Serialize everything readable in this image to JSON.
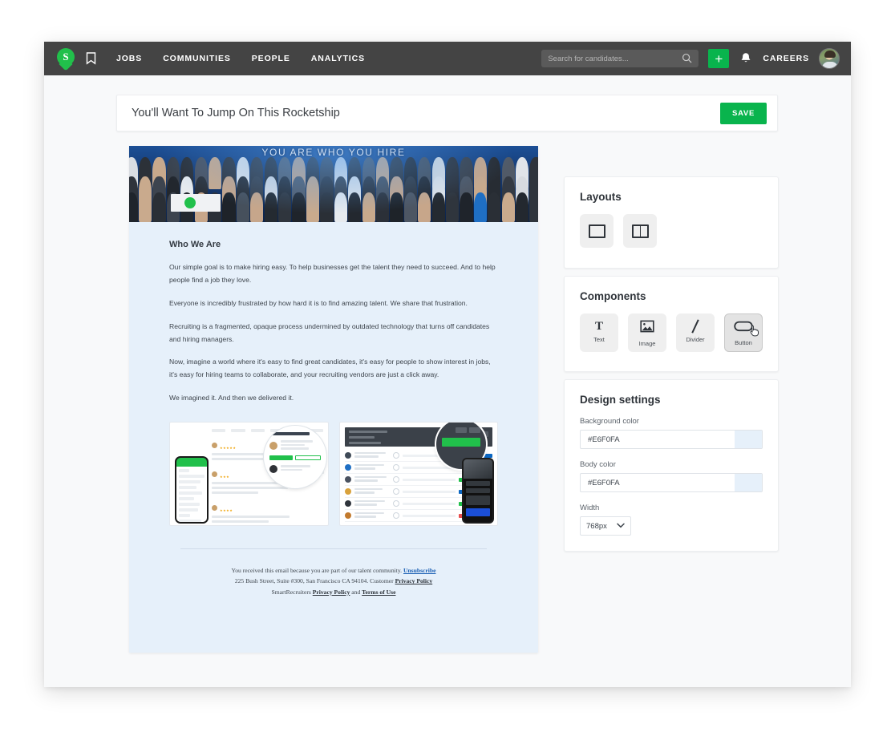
{
  "topnav": {
    "logo_letter": "S",
    "logo_name": "smartrecruiters-logo",
    "bookmark_icon": "bookmark-icon",
    "links": [
      {
        "label": "JOBS"
      },
      {
        "label": "COMMUNITIES"
      },
      {
        "label": "PEOPLE"
      },
      {
        "label": "ANALYTICS"
      }
    ],
    "search": {
      "placeholder": "Search for candidates...",
      "value": ""
    },
    "plus_label": "+",
    "bell_icon": "bell-icon",
    "careers_label": "CAREERS",
    "avatar": "user-avatar"
  },
  "titlebar": {
    "title": "You'll Want To Jump On This Rocketship",
    "save_label": "SAVE"
  },
  "email": {
    "hero_headline": "YOU ARE WHO YOU HIRE",
    "heading": "Who We Are",
    "paragraphs": [
      "Our simple goal is to make hiring easy. To help businesses get the talent they need to succeed. And to help people find a job they love.",
      "Everyone is incredibly frustrated by how hard it is to find amazing talent. We share that frustration.",
      "Recruiting is a fragmented, opaque process undermined by outdated technology that turns off candidates and hiring managers.",
      "Now, imagine a world where it's easy to find great candidates, it's easy for people to show interest in jobs, it's easy for hiring teams to collaborate, and your recruiting vendors are just a click away.",
      "We imagined it. And then we delivered it."
    ],
    "footer": {
      "line1_text": "You received this email because you are part of our talent community. ",
      "line1_link": "Unsubscribe",
      "line2_text": "225 Bush Street, Suite #300, San Francisco CA 94104. Customer ",
      "line2_link": "Privacy Policy",
      "line3_prefix": "SmartRecruiters ",
      "line3_link1": "Privacy Policy",
      "line3_mid": " and ",
      "line3_link2": "Terms of Use"
    }
  },
  "layouts_panel": {
    "title": "Layouts",
    "tiles": [
      {
        "name": "layout-single-column",
        "icon": "single-column-icon"
      },
      {
        "name": "layout-two-column",
        "icon": "two-column-icon"
      }
    ]
  },
  "components_panel": {
    "title": "Components",
    "items": [
      {
        "label": "Text",
        "icon": "text-icon",
        "selected": false
      },
      {
        "label": "Image",
        "icon": "image-icon",
        "selected": false
      },
      {
        "label": "Divider",
        "icon": "divider-icon",
        "selected": false
      },
      {
        "label": "Button",
        "icon": "button-icon",
        "selected": true
      }
    ]
  },
  "design_panel": {
    "title": "Design settings",
    "background_color_label": "Background color",
    "background_color_value": "#E6F0FA",
    "body_color_label": "Body color",
    "body_color_value": "#E6F0FA",
    "width_label": "Width",
    "width_value": "768px"
  },
  "colors": {
    "nav_bg": "#444444",
    "accent_green": "#09b44d",
    "email_bg": "#E6F0FA",
    "canvas_bg": "#f8f9fa"
  }
}
